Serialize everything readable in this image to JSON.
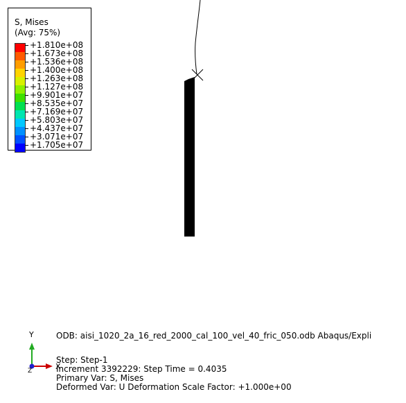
{
  "legend": {
    "title_line1": "S, Mises",
    "title_line2": "(Avg: 75%)",
    "values": [
      "+1.810e+08",
      "+1.673e+08",
      "+1.536e+08",
      "+1.400e+08",
      "+1.263e+08",
      "+1.127e+08",
      "+9.901e+07",
      "+8.535e+07",
      "+7.169e+07",
      "+5.803e+07",
      "+4.437e+07",
      "+3.071e+07",
      "+1.705e+07"
    ],
    "colors": [
      "#ff0000",
      "#ff5a00",
      "#ff9d00",
      "#ffd400",
      "#d8f000",
      "#8ef000",
      "#3ee000",
      "#00e050",
      "#00e6b0",
      "#00c8ff",
      "#0090ff",
      "#0050ff",
      "#0000ff"
    ]
  },
  "triad": {
    "y_label": "Y",
    "x_label": "X",
    "z_label": "Z",
    "y_color": "#22aa22",
    "x_color": "#cc0000",
    "z_color": "#2222cc"
  },
  "info": {
    "odb": "ODB: aisi_1020_2a_16_red_2000_cal_100_vel_40_fric_050.odb    Abaqus/Expli",
    "step": "Step: Step-1",
    "increment": "Increment   3392229: Step Time =    0.4035",
    "primary_var": "Primary Var: S, Mises",
    "deformed_var": "Deformed Var: U   Deformation Scale Factor: +1.000e+00"
  }
}
